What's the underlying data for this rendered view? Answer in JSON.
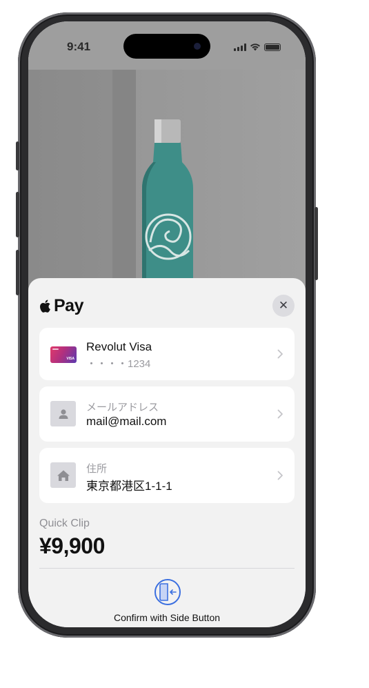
{
  "status_bar": {
    "time": "9:41"
  },
  "apple_pay": {
    "brand_label": "Pay",
    "close_label": "✕"
  },
  "payment_card": {
    "name": "Revolut Visa",
    "number_masked": "・・・・1234"
  },
  "email_row": {
    "label": "メールアドレス",
    "value": "mail@mail.com"
  },
  "address_row": {
    "label": "住所",
    "value": "東京都港区1-1-1"
  },
  "order": {
    "merchant": "Quick Clip",
    "amount": "¥9,900"
  },
  "confirm": {
    "text": "Confirm with Side Button"
  },
  "colors": {
    "accent_blue": "#3b6fe0",
    "sheet_bg": "#f2f2f2",
    "row_bg": "#ffffff"
  }
}
